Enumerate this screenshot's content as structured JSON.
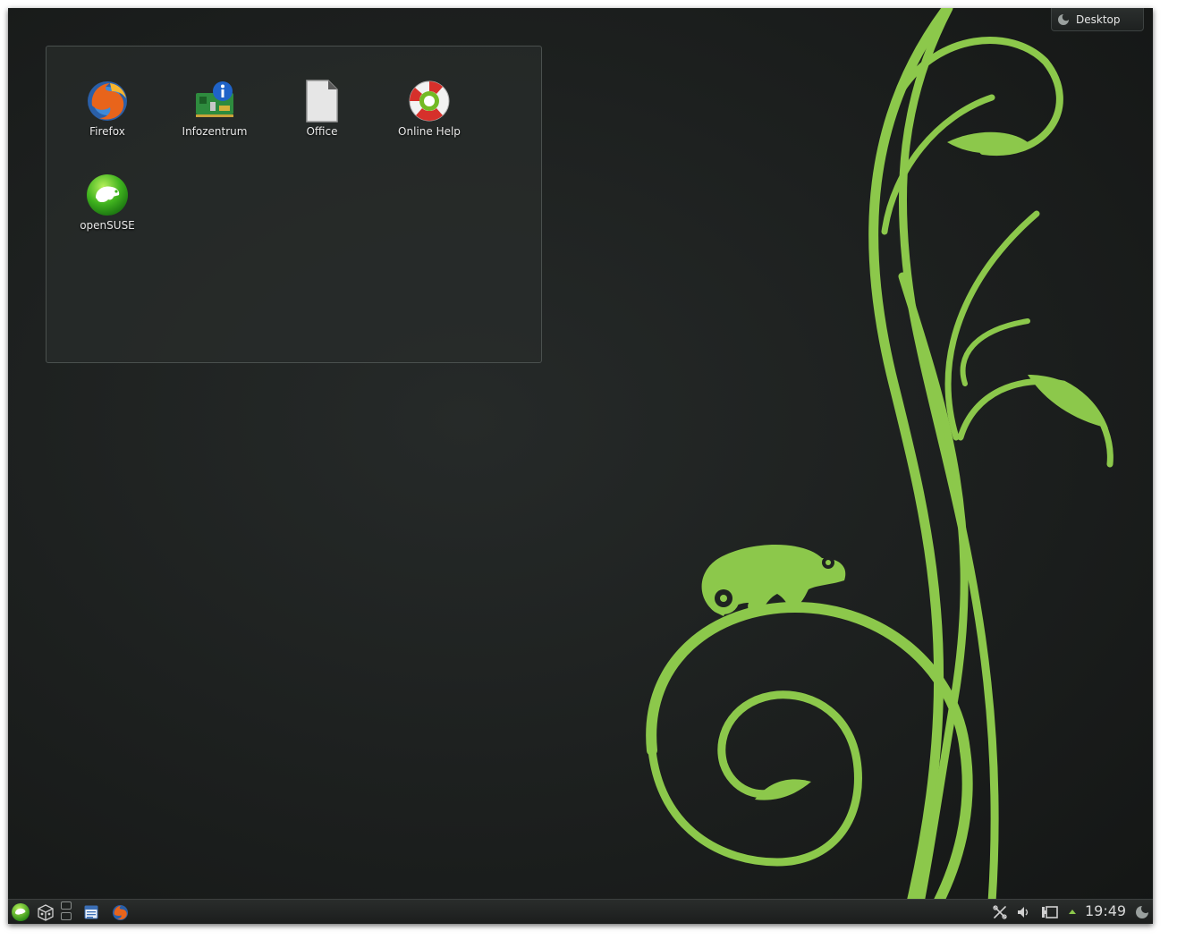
{
  "toolbox": {
    "label": "Desktop"
  },
  "desktop_icons": [
    {
      "label": "Firefox"
    },
    {
      "label": "Infozentrum"
    },
    {
      "label": "Office"
    },
    {
      "label": "Online Help"
    },
    {
      "label": "openSUSE"
    }
  ],
  "panel": {
    "clock": "19:49",
    "launchers": [
      "opensuse-menu-icon",
      "activities-cube-icon",
      "pager",
      "file-manager-icon",
      "firefox-icon"
    ],
    "tray": [
      "network-disconnected-icon",
      "volume-icon",
      "battery-icon",
      "expand-arrow-icon",
      "panel-toolbox-icon"
    ]
  },
  "colors": {
    "wallpaper_bg": "#1c1f1e",
    "wallpaper_green": "#8cc84b",
    "panel_bg": "#1f2221"
  }
}
